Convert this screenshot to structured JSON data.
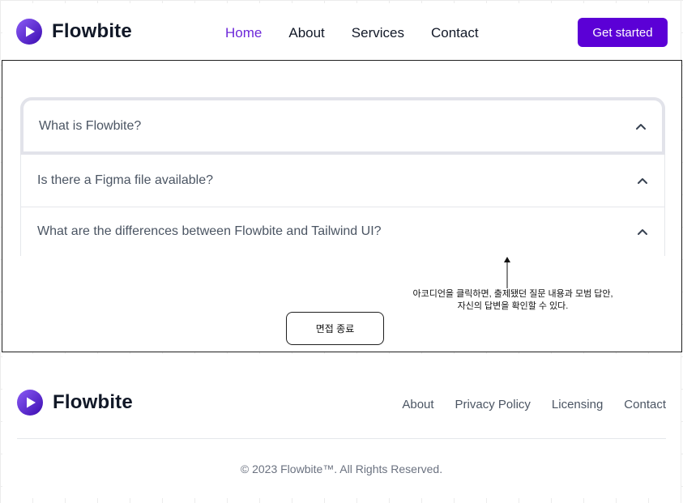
{
  "brand": {
    "name": "Flowbite",
    "logo_icon": "play-icon"
  },
  "navbar": {
    "links": [
      {
        "label": "Home",
        "active": true
      },
      {
        "label": "About",
        "active": false
      },
      {
        "label": "Services",
        "active": false
      },
      {
        "label": "Contact",
        "active": false
      }
    ],
    "cta_label": "Get started"
  },
  "accordion": {
    "items": [
      {
        "question": "What is Flowbite?",
        "icon": "chevron-up-icon"
      },
      {
        "question": "Is there a Figma file available?",
        "icon": "chevron-up-icon"
      },
      {
        "question": "What are the differences between Flowbite and Tailwind UI?",
        "icon": "chevron-up-icon"
      }
    ]
  },
  "annotation": {
    "line1": "아코디언을 클릭하면, 출제됐던 질문 내용과 모범 답안,",
    "line2": "자신의 답변을 확인할 수 있다."
  },
  "end_button_label": "면접 종료",
  "footer": {
    "links": [
      "About",
      "Privacy Policy",
      "Licensing",
      "Contact"
    ],
    "copyright": "© 2023 Flowbite™. All Rights Reserved."
  },
  "colors": {
    "accent": "#5b00d6",
    "active_link": "#6d28d9",
    "logo_gradient_start": "#7c3aed",
    "logo_gradient_end": "#3b0bb0"
  }
}
